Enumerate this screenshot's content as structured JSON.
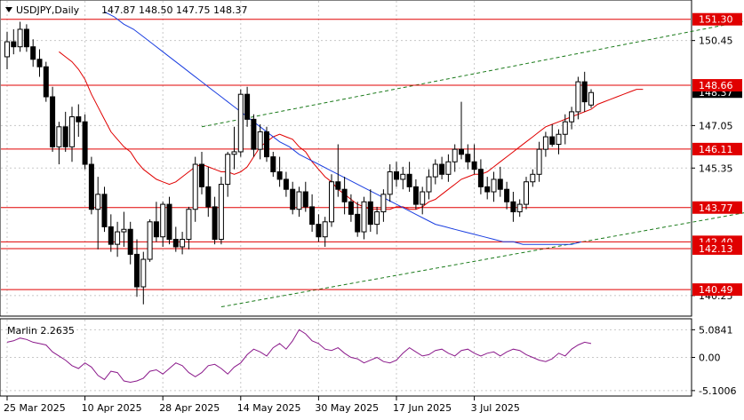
{
  "header": {
    "symbol": "USDJPY,Daily",
    "ohlc": "147.87 148.50 147.75 148.37",
    "menu_icon": "triangle-down-icon"
  },
  "colors": {
    "background": "#ffffff",
    "plot_bg": "#ffffff",
    "grid": "#c8c8c8",
    "bull_fill": "#ffffff",
    "bear_fill": "#000000",
    "candle_line": "#000000",
    "level_line": "#e00000",
    "level_label_bg": "#e00000",
    "level_label_text": "#ffffff",
    "ma_fast": "#e00000",
    "ma_slow": "#1a3ee0",
    "channel": "#1a7a1a",
    "oscillator": "#8b1a8b",
    "current_price_bg": "#000000"
  },
  "chart_data": [
    {
      "type": "candlestick",
      "title": "USDJPY,Daily",
      "ohlc_readout": "147.87 148.50 147.75 148.37",
      "ylim": [
        139.5,
        152.0
      ],
      "price_axis_ticks": [
        "150.45",
        "147.05",
        "145.35",
        "140.25"
      ],
      "current_price": 148.37,
      "current_price_label": "148.37",
      "horizontal_levels": [
        {
          "value": 151.3,
          "label": "151.30"
        },
        {
          "value": 148.66,
          "label": "148.66"
        },
        {
          "value": 146.11,
          "label": "146.11"
        },
        {
          "value": 143.77,
          "label": "143.77"
        },
        {
          "value": 142.4,
          "label": "142.40"
        },
        {
          "value": 142.13,
          "label": "142.13"
        },
        {
          "value": 140.49,
          "label": "140.49"
        }
      ],
      "x_axis_labels": [
        {
          "index": 0,
          "label": "25 Mar 2025"
        },
        {
          "index": 12,
          "label": "10 Apr 2025"
        },
        {
          "index": 24,
          "label": "28 Apr 2025"
        },
        {
          "index": 36,
          "label": "14 May 2025"
        },
        {
          "index": 48,
          "label": "30 May 2025"
        },
        {
          "index": 60,
          "label": "17 Jun 2025"
        },
        {
          "index": 72,
          "label": "3 Jul 2025"
        }
      ],
      "series": [
        {
          "kind": "ohlc",
          "candles": [
            [
              149.8,
              150.8,
              149.3,
              150.4
            ],
            [
              150.4,
              150.9,
              149.9,
              150.2
            ],
            [
              150.2,
              151.2,
              150.0,
              150.9
            ],
            [
              150.9,
              151.1,
              150.0,
              150.2
            ],
            [
              150.2,
              150.5,
              149.4,
              149.7
            ],
            [
              149.7,
              150.1,
              149.0,
              149.4
            ],
            [
              149.4,
              149.6,
              148.0,
              148.2
            ],
            [
              148.2,
              148.6,
              146.0,
              146.2
            ],
            [
              146.2,
              147.2,
              145.5,
              147.0
            ],
            [
              147.0,
              147.6,
              146.0,
              146.2
            ],
            [
              146.2,
              147.8,
              145.6,
              147.4
            ],
            [
              147.4,
              147.9,
              146.6,
              147.2
            ],
            [
              147.2,
              147.5,
              145.3,
              145.5
            ],
            [
              145.5,
              145.8,
              143.5,
              143.7
            ],
            [
              143.7,
              145.0,
              142.1,
              144.3
            ],
            [
              144.3,
              144.6,
              142.8,
              143.0
            ],
            [
              143.0,
              143.5,
              142.0,
              142.3
            ],
            [
              142.3,
              143.2,
              141.8,
              142.8
            ],
            [
              142.8,
              143.6,
              142.2,
              142.9
            ],
            [
              142.9,
              143.2,
              141.5,
              141.9
            ],
            [
              141.9,
              142.5,
              140.2,
              140.6
            ],
            [
              140.6,
              142.0,
              139.9,
              141.7
            ],
            [
              141.7,
              143.3,
              141.6,
              143.2
            ],
            [
              143.2,
              144.0,
              142.4,
              142.6
            ],
            [
              142.6,
              144.0,
              142.2,
              143.9
            ],
            [
              143.9,
              144.2,
              142.3,
              142.5
            ],
            [
              142.5,
              143.0,
              142.0,
              142.2
            ],
            [
              142.2,
              142.8,
              141.9,
              142.5
            ],
            [
              142.5,
              143.8,
              142.1,
              143.7
            ],
            [
              143.7,
              145.8,
              143.2,
              145.5
            ],
            [
              145.5,
              146.0,
              144.3,
              144.6
            ],
            [
              144.6,
              145.4,
              143.4,
              143.8
            ],
            [
              143.8,
              144.2,
              142.3,
              142.5
            ],
            [
              142.5,
              145.0,
              142.3,
              144.7
            ],
            [
              144.7,
              146.0,
              144.2,
              145.9
            ],
            [
              145.9,
              147.0,
              145.3,
              146.0
            ],
            [
              146.0,
              148.5,
              145.8,
              148.3
            ],
            [
              148.3,
              148.6,
              147.0,
              147.3
            ],
            [
              147.3,
              147.5,
              145.8,
              146.1
            ],
            [
              146.1,
              147.1,
              145.7,
              146.8
            ],
            [
              146.8,
              147.0,
              145.6,
              145.8
            ],
            [
              145.8,
              146.0,
              145.0,
              145.2
            ],
            [
              145.2,
              145.8,
              144.6,
              144.9
            ],
            [
              144.9,
              145.2,
              144.2,
              144.5
            ],
            [
              144.5,
              144.8,
              143.5,
              143.7
            ],
            [
              143.7,
              144.6,
              143.4,
              144.4
            ],
            [
              144.4,
              144.8,
              143.6,
              143.8
            ],
            [
              143.8,
              144.3,
              142.8,
              143.1
            ],
            [
              143.1,
              143.5,
              142.4,
              142.6
            ],
            [
              142.6,
              143.4,
              142.2,
              143.2
            ],
            [
              143.2,
              145.1,
              143.0,
              144.8
            ],
            [
              144.8,
              146.3,
              144.2,
              144.5
            ],
            [
              144.5,
              145.0,
              143.5,
              144.0
            ],
            [
              144.0,
              144.3,
              143.2,
              143.5
            ],
            [
              143.5,
              144.0,
              142.6,
              142.8
            ],
            [
              142.8,
              144.2,
              142.5,
              144.0
            ],
            [
              144.0,
              144.5,
              142.8,
              143.1
            ],
            [
              143.1,
              143.8,
              142.7,
              143.6
            ],
            [
              143.6,
              144.5,
              143.2,
              144.3
            ],
            [
              144.3,
              145.5,
              144.0,
              145.2
            ],
            [
              145.2,
              145.6,
              144.6,
              144.9
            ],
            [
              144.9,
              145.4,
              144.5,
              145.1
            ],
            [
              145.1,
              145.6,
              144.4,
              144.6
            ],
            [
              144.6,
              144.9,
              143.7,
              143.9
            ],
            [
              143.9,
              144.6,
              143.5,
              144.4
            ],
            [
              144.4,
              145.3,
              144.1,
              145.0
            ],
            [
              145.0,
              145.7,
              144.7,
              145.5
            ],
            [
              145.5,
              145.8,
              144.9,
              145.1
            ],
            [
              145.1,
              145.9,
              144.8,
              145.6
            ],
            [
              145.6,
              146.3,
              145.2,
              146.1
            ],
            [
              146.1,
              148.0,
              145.7,
              145.9
            ],
            [
              145.9,
              146.3,
              145.3,
              145.6
            ],
            [
              145.6,
              146.3,
              145.1,
              145.3
            ],
            [
              145.3,
              145.7,
              144.3,
              144.6
            ],
            [
              144.6,
              145.0,
              144.1,
              144.4
            ]
          ]
        },
        {
          "kind": "ohlc_continued",
          "candles": [
            [
              144.4,
              145.2,
              144.0,
              144.9
            ],
            [
              144.9,
              145.4,
              144.2,
              144.5
            ],
            [
              144.5,
              144.8,
              143.7,
              144.0
            ],
            [
              144.0,
              144.4,
              143.2,
              143.6
            ],
            [
              143.6,
              144.1,
              143.4,
              143.9
            ],
            [
              143.9,
              145.0,
              143.7,
              144.8
            ],
            [
              144.8,
              145.3,
              144.6,
              145.1
            ],
            [
              145.1,
              146.4,
              144.8,
              146.1
            ],
            [
              146.1,
              146.8,
              145.8,
              146.6
            ],
            [
              146.6,
              147.1,
              146.2,
              146.3
            ],
            [
              146.3,
              146.9,
              145.9,
              146.7
            ],
            [
              146.7,
              147.5,
              146.3,
              147.2
            ],
            [
              147.2,
              147.8,
              146.9,
              147.6
            ],
            [
              147.6,
              149.0,
              147.3,
              148.8
            ],
            [
              148.8,
              149.2,
              147.6,
              148.0
            ],
            [
              147.87,
              148.5,
              147.75,
              148.37
            ]
          ]
        }
      ],
      "ma_fast_values": [
        150.0,
        149.8,
        149.6,
        149.3,
        148.9,
        148.3,
        147.8,
        147.3,
        146.8,
        146.5,
        146.2,
        146.0,
        145.6,
        145.3,
        145.1,
        144.9,
        144.8,
        144.7,
        144.8,
        145.0,
        145.2,
        145.4,
        145.5,
        145.4,
        145.3,
        145.2,
        145.2,
        145.1,
        145.2,
        145.4,
        145.8,
        146.2,
        146.4,
        146.6,
        146.7,
        146.6,
        146.5,
        146.2,
        146.0,
        145.6,
        145.3,
        145.0,
        144.8,
        144.5,
        144.3,
        144.1,
        143.9,
        143.8,
        143.7,
        143.7,
        143.7,
        143.7,
        143.8,
        143.8,
        143.7,
        143.7,
        143.8,
        144.0,
        144.1,
        144.3,
        144.5,
        144.7,
        144.9,
        145.0,
        145.1,
        145.1,
        145.2,
        145.4,
        145.6,
        145.8,
        146.0,
        146.2,
        146.4,
        146.6,
        146.8,
        147.0,
        147.1,
        147.2,
        147.3,
        147.4,
        147.5,
        147.6,
        147.7,
        147.9,
        148.0,
        148.1,
        148.2,
        148.3,
        148.4,
        148.5,
        148.5
      ],
      "ma_slow_values": [
        151.6,
        151.4,
        151.1,
        150.9,
        150.6,
        150.3,
        150.0,
        149.7,
        149.4,
        149.1,
        148.8,
        148.5,
        148.2,
        147.9,
        147.6,
        147.3,
        147.0,
        146.7,
        146.4,
        146.2,
        145.9,
        145.7,
        145.5,
        145.3,
        145.1,
        144.9,
        144.7,
        144.5,
        144.3,
        144.1,
        143.9,
        143.7,
        143.5,
        143.3,
        143.1,
        143.0,
        142.9,
        142.8,
        142.7,
        142.6,
        142.5,
        142.4,
        142.4,
        142.3,
        142.3,
        142.3,
        142.3,
        142.3,
        142.3,
        142.4
      ],
      "trend_channel_upper": {
        "x_start": 30,
        "y_start": 147.0,
        "x_end": 123,
        "y_end": 151.7
      },
      "trend_channel_lower": {
        "x_start": 33,
        "y_start": 139.8,
        "x_end": 123,
        "y_end": 144.0
      }
    },
    {
      "type": "line",
      "title": "Marlin 2.2635",
      "ylim": [
        -1.3,
        1.3
      ],
      "y_axis_ticks": [
        "5.0841",
        "0.00",
        "-5.1006"
      ],
      "series": [
        {
          "name": "Marlin",
          "values": [
            0.55,
            0.6,
            0.7,
            0.65,
            0.55,
            0.5,
            0.45,
            0.2,
            0.05,
            -0.1,
            -0.3,
            -0.4,
            -0.2,
            -0.35,
            -0.65,
            -0.8,
            -0.5,
            -0.55,
            -0.85,
            -0.9,
            -0.85,
            -0.75,
            -0.5,
            -0.45,
            -0.6,
            -0.4,
            -0.2,
            -0.3,
            -0.55,
            -0.7,
            -0.55,
            -0.3,
            -0.25,
            -0.4,
            -0.6,
            -0.35,
            -0.2,
            0.1,
            0.3,
            0.2,
            0.05,
            0.35,
            0.5,
            0.3,
            0.6,
            1.0,
            0.85,
            0.6,
            0.5,
            0.3,
            0.25,
            0.35,
            0.15,
            0.0,
            -0.05,
            -0.2,
            -0.1,
            0.0,
            -0.15,
            -0.2,
            -0.1,
            0.15,
            0.35,
            0.2,
            0.05,
            0.1,
            0.25,
            0.3,
            0.15,
            0.05,
            0.25,
            0.3,
            0.15,
            0.05,
            0.15,
            0.2,
            0.05,
            0.2,
            0.3,
            0.25,
            0.1,
            0.0,
            -0.1,
            -0.15,
            -0.05,
            0.15,
            0.05,
            0.3,
            0.45,
            0.55,
            0.5
          ]
        }
      ]
    }
  ]
}
